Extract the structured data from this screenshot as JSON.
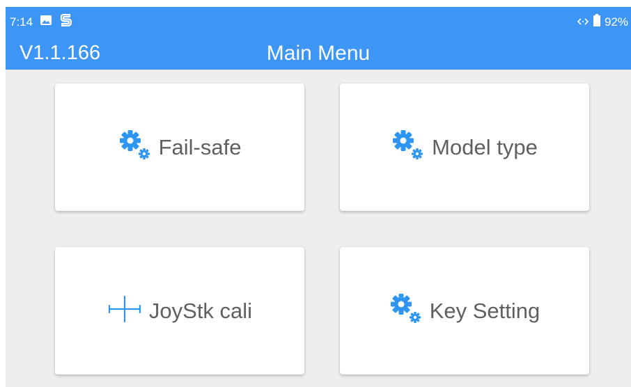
{
  "status_bar": {
    "time": "7:14",
    "battery": "92%",
    "icons": [
      "image-icon",
      "app-s-icon",
      "network-arrows-icon",
      "battery-icon"
    ]
  },
  "app_bar": {
    "version": "V1.1.166",
    "title": "Main Menu"
  },
  "menu": {
    "items": [
      {
        "label": "Fail-safe",
        "icon": "gears-icon"
      },
      {
        "label": "Model type",
        "icon": "gears-icon"
      },
      {
        "label": "JoyStk cali",
        "icon": "crosshair-icon"
      },
      {
        "label": "Key Setting",
        "icon": "gears-icon"
      }
    ]
  },
  "colors": {
    "accent": "#3d96f5",
    "icon_blue": "#2e96f0",
    "background": "#eeeeee",
    "card": "#ffffff",
    "label_text": "#5f5f5f"
  }
}
